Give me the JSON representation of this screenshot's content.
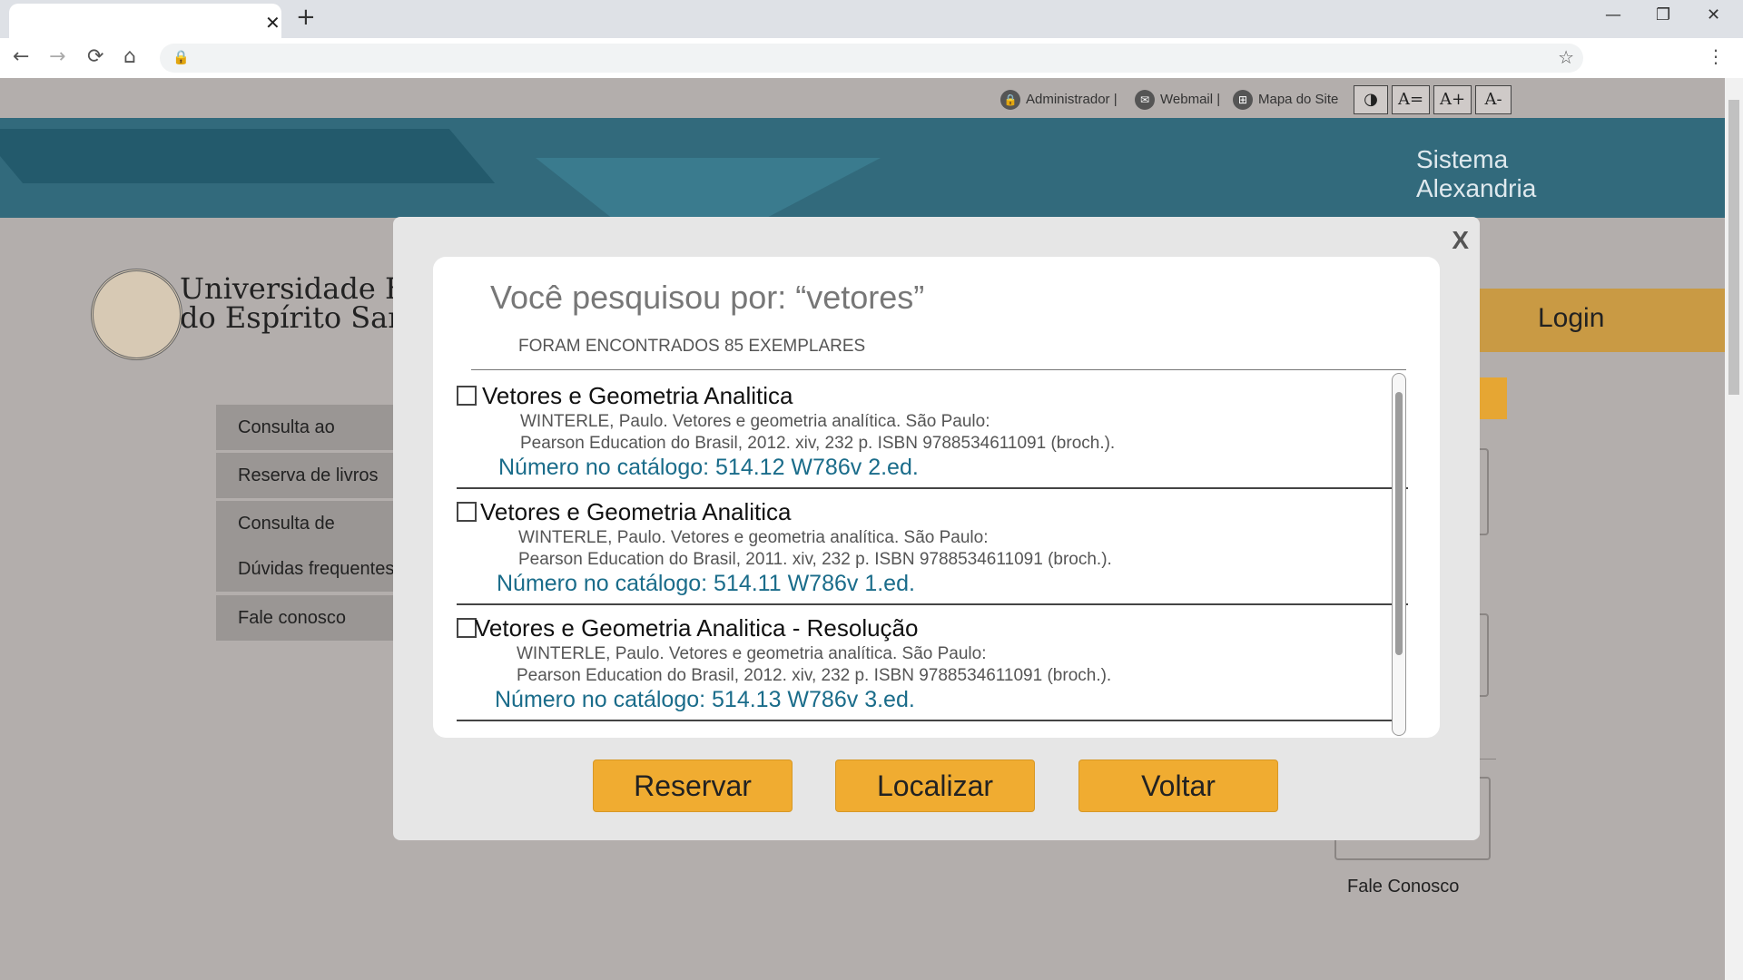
{
  "browser": {
    "tab_close": "✕",
    "new_tab": "+",
    "minimize": "—",
    "restore": "❐",
    "close": "✕",
    "back": "←",
    "forward": "→",
    "reload": "⟳",
    "home": "⌂",
    "lock": "🔒",
    "star": "☆",
    "menu": "⋮"
  },
  "topbar": {
    "admin_label": "Administrador",
    "sep": "|",
    "webmail_label": "Webmail",
    "sitemap_label": "Mapa do Site",
    "contrast_label": "◑",
    "font_reset_label": "A=",
    "font_increase_label": "A+",
    "font_decrease_label": "A-"
  },
  "brand": {
    "system_line1": "Sistema",
    "system_line2": "Alexandria",
    "university_line1": "Universidade Federal",
    "university_line2": "do Espírito Santo",
    "login_label": "Login"
  },
  "sidebar": {
    "items": [
      {
        "label": "Consulta ao catálogo"
      },
      {
        "label": "Reserva de livros"
      },
      {
        "label": "Consulta de débitos"
      },
      {
        "label": "Dúvidas frequentes"
      },
      {
        "label": "Fale conosco"
      }
    ]
  },
  "right_panel": {
    "fale_label": "Fale Conosco"
  },
  "modal": {
    "close_label": "X",
    "query_title": "Você pesquisou por: “vetores”",
    "count_text": "FORAM ENCONTRADOS 85 EXEMPLARES",
    "results": [
      {
        "title": "Vetores e Geometria Analitica",
        "desc_line1": "WINTERLE, Paulo. Vetores e geometria analítica. São Paulo:",
        "desc_line2": "Pearson Education do Brasil, 2012. xiv, 232 p. ISBN 9788534611091 (broch.).",
        "catalog": "Número no catálogo: 514.12 W786v 2.ed."
      },
      {
        "title": "Vetores e Geometria Analitica",
        "desc_line1": "WINTERLE, Paulo. Vetores e geometria analítica. São Paulo:",
        "desc_line2": "Pearson Education do Brasil, 2011. xiv, 232 p. ISBN 9788534611091 (broch.).",
        "catalog": "Número no catálogo: 514.11 W786v 1.ed."
      },
      {
        "title": "Vetores e Geometria Analitica - Resolução",
        "desc_line1": "WINTERLE, Paulo. Vetores e geometria analítica. São Paulo:",
        "desc_line2": "Pearson Education do Brasil, 2012. xiv, 232 p. ISBN 9788534611091 (broch.).",
        "catalog": "Número no catálogo: 514.13 W786v 3.ed."
      }
    ],
    "buttons": {
      "reservar": "Reservar",
      "localizar": "Localizar",
      "voltar": "Voltar"
    }
  }
}
